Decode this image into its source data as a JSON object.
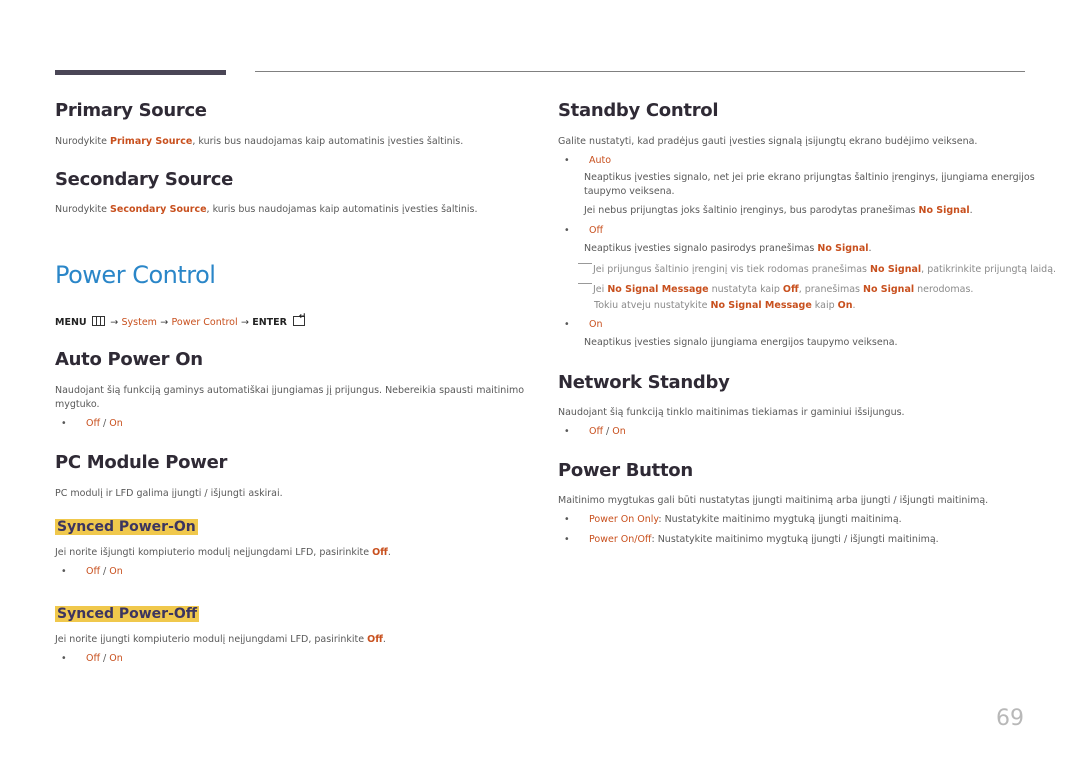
{
  "page_number": "69",
  "left": {
    "primary_source": {
      "title": "Primary Source",
      "text_pre": "Nurodykite ",
      "text_hl": "Primary Source",
      "text_post": ", kuris bus naudojamas kaip automatinis įvesties šaltinis."
    },
    "secondary_source": {
      "title": "Secondary Source",
      "text_pre": "Nurodykite ",
      "text_hl": "Secondary Source",
      "text_post": ", kuris bus naudojamas kaip automatinis įvesties šaltinis."
    },
    "power_control": {
      "title": "Power Control",
      "menu": {
        "menu_label": "MENU",
        "arrow": "→",
        "system": "System",
        "power_control": "Power Control",
        "enter_label": "ENTER"
      }
    },
    "auto_power_on": {
      "title": "Auto Power On",
      "text_line1": "Naudojant šią funkciją gaminys automatiškai įjungiamas jį prijungus. Nebereikia spausti maitinimo",
      "text_line2": "mygtuko.",
      "opt_off": "Off",
      "sep": " / ",
      "opt_on": "On"
    },
    "pc_module_power": {
      "title": "PC Module Power",
      "text": "PC modulį ir LFD galima įjungti / išjungti askirai.",
      "synced_on": {
        "title": "Synced Power-On",
        "text_pre": "Jei norite išjungti kompiuterio modulį neįjungdami LFD, pasirinkite ",
        "text_hl": "Off",
        "text_post": ".",
        "opt_off": "Off",
        "sep": " / ",
        "opt_on": "On"
      },
      "synced_off": {
        "title": "Synced Power-Off",
        "text_pre": "Jei norite įjungti kompiuterio modulį neįjungdami LFD, pasirinkite ",
        "text_hl": "Off",
        "text_post": ".",
        "opt_off": "Off",
        "sep": " / ",
        "opt_on": "On"
      }
    }
  },
  "right": {
    "standby_control": {
      "title": "Standby Control",
      "intro": "Galite nustatyti, kad pradėjus gauti įvesties signalą įsijungtų ekrano budėjimo veiksena.",
      "auto": {
        "label": "Auto",
        "line1": "Neaptikus įvesties signalo, net jei prie ekrano prijungtas šaltinio įrenginys, įjungiama energijos",
        "line2": "taupymo veiksena.",
        "line3_pre": "Jei nebus prijungtas joks šaltinio įrenginys, bus parodytas pranešimas ",
        "line3_hl": "No Signal",
        "line3_post": "."
      },
      "off": {
        "label": "Off",
        "line1_pre": "Neaptikus įvesties signalo pasirodys pranešimas ",
        "line1_hl": "No Signal",
        "line1_post": ".",
        "note1_pre": "Jei prijungus šaltinio įrenginį vis tiek rodomas pranešimas ",
        "note1_hl": "No Signal",
        "note1_post": ", patikrinkite prijungtą laidą.",
        "note2_pre": "Jei ",
        "note2_hl1": "No Signal Message",
        "note2_mid1": " nustatyta kaip ",
        "note2_hl2": "Off",
        "note2_mid2": ", pranešimas ",
        "note2_hl3": "No Signal",
        "note2_post": " nerodomas.",
        "note3_pre": "Tokiu atveju nustatykite ",
        "note3_hl1": "No Signal Message",
        "note3_mid": " kaip ",
        "note3_hl2": "On",
        "note3_post": "."
      },
      "on": {
        "label": "On",
        "line1": "Neaptikus įvesties signalo įjungiama energijos taupymo veiksena."
      }
    },
    "network_standby": {
      "title": "Network Standby",
      "text": "Naudojant šią funkciją tinklo maitinimas tiekiamas ir gaminiui išsijungus.",
      "opt_off": "Off",
      "sep": " / ",
      "opt_on": "On"
    },
    "power_button": {
      "title": "Power Button",
      "text": "Maitinimo mygtukas gali būti nustatytas įjungti maitinimą arba įjungti / išjungti maitinimą.",
      "items": [
        {
          "label": "Power On Only",
          "desc": ": Nustatykite maitinimo mygtuką įjungti maitinimą."
        },
        {
          "label": "Power On/Off",
          "desc": ": Nustatykite maitinimo mygtuką įjungti / išjungti maitinimą."
        }
      ]
    }
  }
}
